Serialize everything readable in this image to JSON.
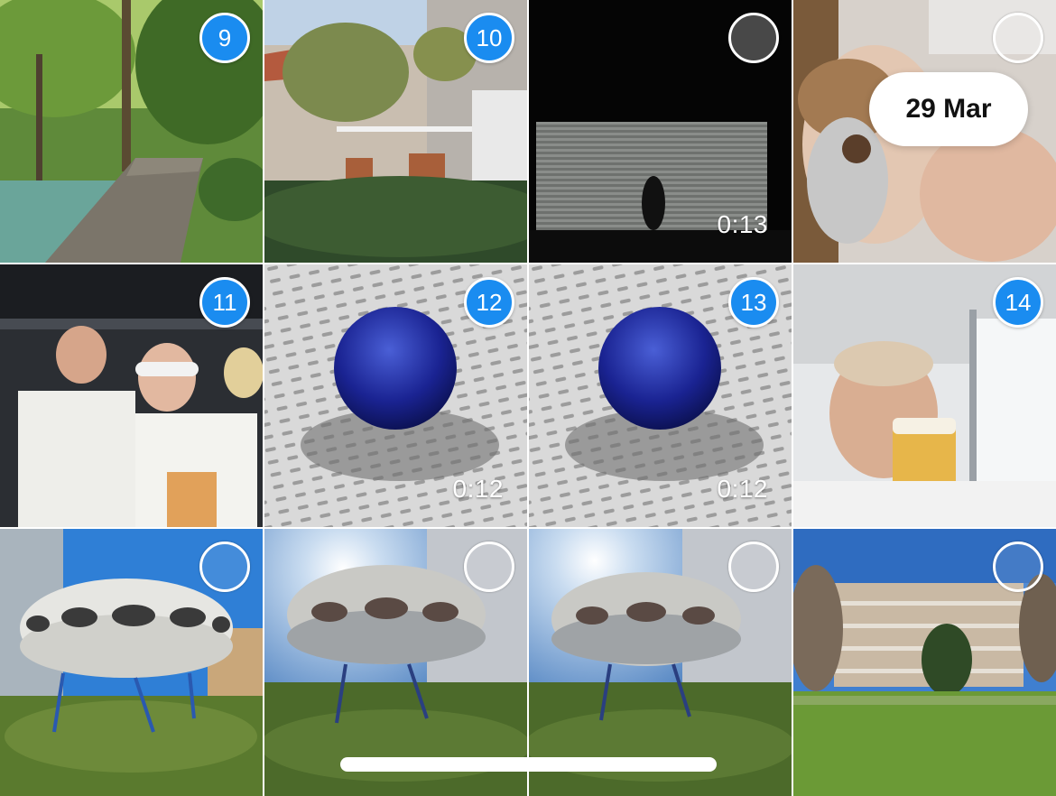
{
  "photos": [
    {
      "scene": "forest-boardwalk",
      "badge": "9",
      "selected": true
    },
    {
      "scene": "house-terrace",
      "badge": "10",
      "selected": true
    },
    {
      "scene": "dark-stage-video",
      "badge": "",
      "selected": false,
      "duration": "0:13"
    },
    {
      "scene": "selfie-cookie",
      "badge": "",
      "selected": false
    },
    {
      "scene": "concert-crowd",
      "badge": "11",
      "selected": true
    },
    {
      "scene": "blue-ball-video",
      "badge": "12",
      "selected": true,
      "duration": "0:12"
    },
    {
      "scene": "blue-ball-video",
      "badge": "13",
      "selected": true,
      "duration": "0:12"
    },
    {
      "scene": "beer-selfie",
      "badge": "14",
      "selected": true
    },
    {
      "scene": "futuro-house",
      "badge": "",
      "selected": false
    },
    {
      "scene": "futuro-house-sun",
      "badge": "",
      "selected": false
    },
    {
      "scene": "futuro-house-sun",
      "badge": "",
      "selected": false
    },
    {
      "scene": "apartment-lawn",
      "badge": "",
      "selected": false
    }
  ],
  "date_label": "29 Mar",
  "colors": {
    "selection_blue": "#1a8cf0",
    "badge_text": "#ffffff",
    "pill_background": "#ffffff"
  }
}
